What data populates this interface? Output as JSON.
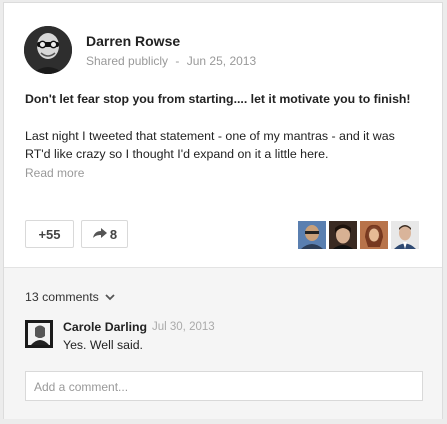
{
  "post": {
    "author": "Darren Rowse",
    "visibility": "Shared publicly",
    "separator": "-",
    "date": "Jun 25, 2013",
    "headline": "Don't let fear stop you from starting.... let it motivate you to finish!",
    "body_line1": "Last night I tweeted that statement - one of my mantras - and it was",
    "body_line2": "RT'd like crazy so I thought I'd expand on it a little here.",
    "read_more": "Read more"
  },
  "actions": {
    "plus_label": "+55",
    "share_count": "8",
    "plus_icon": "plus-one-icon",
    "share_icon": "share-arrow-icon"
  },
  "sharers": [
    {
      "name": "sharer-avatar-1"
    },
    {
      "name": "sharer-avatar-2"
    },
    {
      "name": "sharer-avatar-3"
    },
    {
      "name": "sharer-avatar-4"
    }
  ],
  "comments": {
    "count_label": "13 comments",
    "items": [
      {
        "author": "Carole Darling",
        "date": "Jul 30, 2013",
        "text": "Yes. Well said."
      }
    ],
    "add_placeholder": "Add a comment..."
  },
  "colors": {
    "card": "#ffffff",
    "background": "#ececec",
    "muted_text": "#999999",
    "comment_area": "#f5f5f5"
  }
}
